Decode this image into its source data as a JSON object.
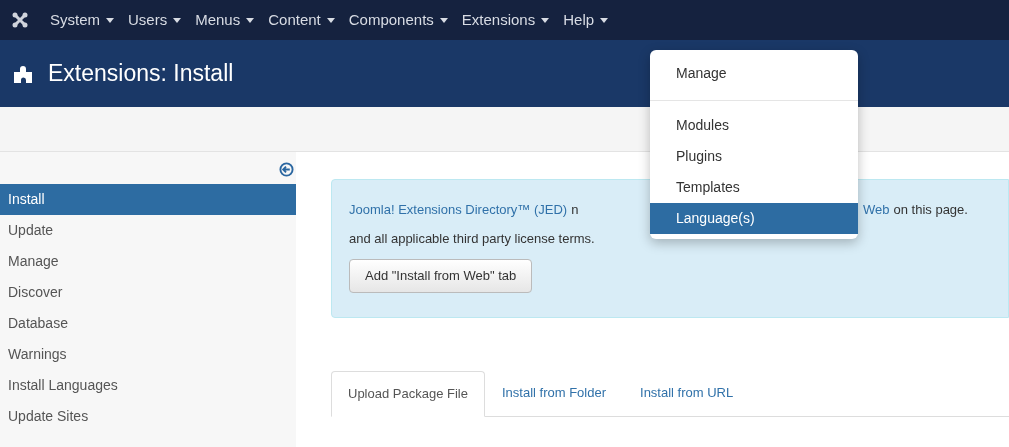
{
  "top_menu": [
    {
      "label": "System"
    },
    {
      "label": "Users"
    },
    {
      "label": "Menus"
    },
    {
      "label": "Content"
    },
    {
      "label": "Components"
    },
    {
      "label": "Extensions"
    },
    {
      "label": "Help"
    }
  ],
  "dropdown": [
    {
      "kind": "item",
      "label": "Manage",
      "selected": false
    },
    {
      "kind": "divider"
    },
    {
      "kind": "item",
      "label": "Modules",
      "selected": false
    },
    {
      "kind": "item",
      "label": "Plugins",
      "selected": false
    },
    {
      "kind": "item",
      "label": "Templates",
      "selected": false
    },
    {
      "kind": "item",
      "label": "Language(s)",
      "selected": true
    }
  ],
  "page_title": "Extensions: Install",
  "sidebar": [
    {
      "label": "Install",
      "selected": true
    },
    {
      "label": "Update",
      "selected": false
    },
    {
      "label": "Manage",
      "selected": false
    },
    {
      "label": "Discover",
      "selected": false
    },
    {
      "label": "Database",
      "selected": false
    },
    {
      "label": "Warnings",
      "selected": false
    },
    {
      "label": "Install Languages",
      "selected": false
    },
    {
      "label": "Update Sites",
      "selected": false
    }
  ],
  "alert": {
    "left_link": "Joomla! Extensions Directory™ (JED)",
    "left_text": "n",
    "right_link": "Web",
    "right_text": "on this page.",
    "line_2": "and all applicable third party license terms.",
    "button": "Add \"Install from Web\" tab"
  },
  "tabs": [
    {
      "label": "Upload Package File",
      "selected": true
    },
    {
      "label": "Install from Folder",
      "selected": false
    },
    {
      "label": "Install from URL",
      "selected": false
    }
  ]
}
